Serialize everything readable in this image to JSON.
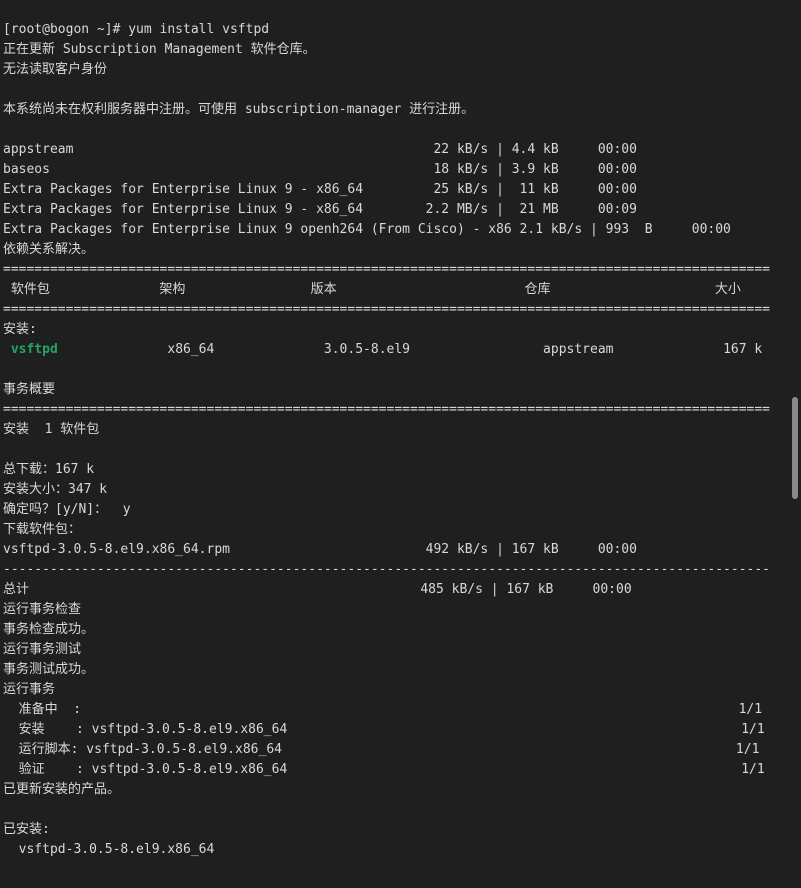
{
  "terminal": {
    "lines": [
      "[root@bogon ~]# yum install vsftpd",
      "正在更新 Subscription Management 软件仓库。",
      "无法读取客户身份",
      "",
      "本系统尚未在权利服务器中注册。可使用 subscription-manager 进行注册。",
      "",
      "appstream                                              22 kB/s | 4.4 kB     00:00",
      "baseos                                                 18 kB/s | 3.9 kB     00:00",
      "Extra Packages for Enterprise Linux 9 - x86_64         25 kB/s |  11 kB     00:00",
      "Extra Packages for Enterprise Linux 9 - x86_64        2.2 MB/s |  21 MB     00:09",
      "Extra Packages for Enterprise Linux 9 openh264 (From Cisco) - x86 2.1 kB/s | 993  B     00:00",
      "依赖关系解决。",
      "==================================================================================================",
      " 软件包              架构                版本                        仓库                     大小",
      "==================================================================================================",
      "安装:",
      " vsftpd              x86_64              3.0.5-8.el9                 appstream              167 k",
      "",
      "事务概要",
      "==================================================================================================",
      "安装  1 软件包",
      "",
      "总下载：167 k",
      "安装大小：347 k",
      "确定吗？[y/N]：  y",
      "下载软件包：",
      "vsftpd-3.0.5-8.el9.x86_64.rpm                         492 kB/s | 167 kB     00:00",
      "--------------------------------------------------------------------------------------------------",
      "总计                                                  485 kB/s | 167 kB     00:00",
      "运行事务检查",
      "事务检查成功。",
      "运行事务测试",
      "事务测试成功。",
      "运行事务",
      "  准备中  :                                                                                    1/1",
      "  安装    : vsftpd-3.0.5-8.el9.x86_64                                                          1/1",
      "  运行脚本: vsftpd-3.0.5-8.el9.x86_64                                                          1/1",
      "  验证    : vsftpd-3.0.5-8.el9.x86_64                                                          1/1",
      "已更新安装的产品。",
      "",
      "已安装:",
      "  vsftpd-3.0.5-8.el9.x86_64"
    ],
    "highlight": {
      "prefix": " ",
      "package": "vsftpd",
      "rest": "              x86_64              3.0.5-8.el9                 appstream              167 k"
    }
  },
  "colors": {
    "background": "#1f1f1f",
    "foreground": "#d8d8d8",
    "package_highlight": "#26a269",
    "scrollbar_thumb": "#8a8a8a"
  }
}
